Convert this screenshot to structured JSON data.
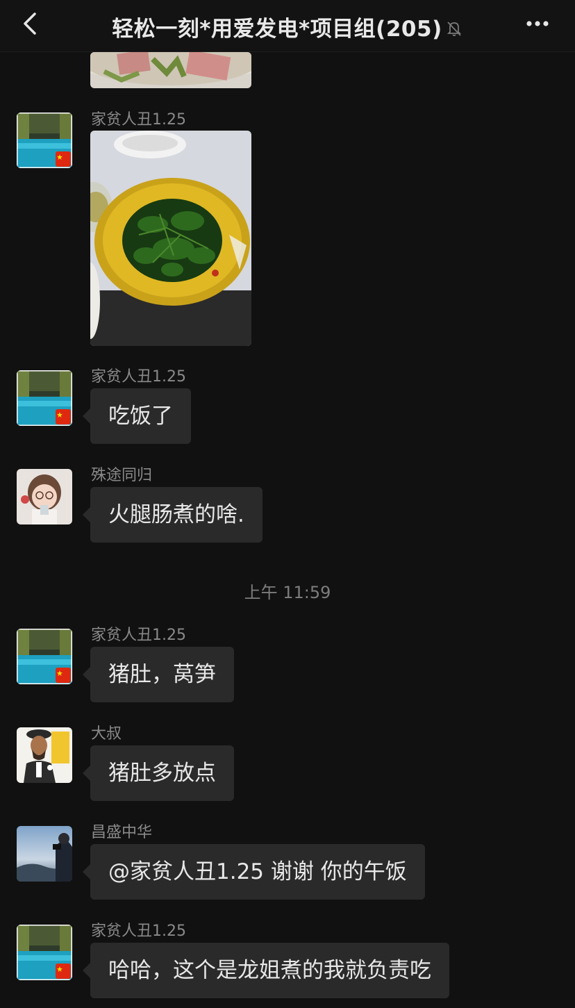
{
  "header": {
    "title": "轻松一刻*用爱发电*项目组(205)",
    "back_icon": "chevron-left-icon",
    "mute_icon": "bell-off-icon",
    "more_icon": "ellipsis-icon"
  },
  "messages": [
    {
      "type": "image",
      "content": "food-photo-ham-sausage",
      "partial": true
    },
    {
      "sender": "家贫人丑1.25",
      "type": "image",
      "content": "food-photo-stir-fried-greens"
    },
    {
      "sender": "家贫人丑1.25",
      "type": "text",
      "text": "吃饭了"
    },
    {
      "sender": "殊途同归",
      "type": "text",
      "text": "火腿肠煮的啥."
    },
    {
      "type": "time",
      "text": "上午 11:59"
    },
    {
      "sender": "家贫人丑1.25",
      "type": "text",
      "text": "猪肚，莴笋"
    },
    {
      "sender": "大叔",
      "type": "text",
      "text": "猪肚多放点"
    },
    {
      "sender": "昌盛中华",
      "type": "text",
      "text": "@家贫人丑1.25  谢谢 你的午饭"
    },
    {
      "sender": "家贫人丑1.25",
      "type": "text",
      "text": "哈哈，这个是龙姐煮的我就负责吃"
    }
  ],
  "colors": {
    "background": "#111111",
    "bubble": "#2a2a2a",
    "text": "#e8e8e8",
    "sender": "#8a8a8a"
  }
}
